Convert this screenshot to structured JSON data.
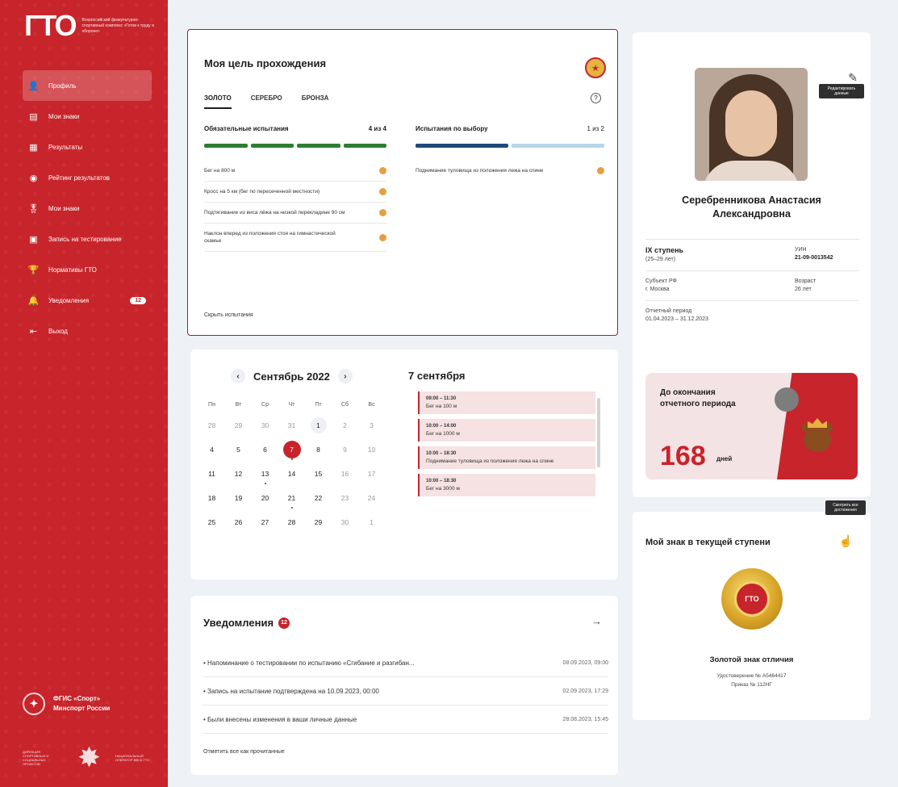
{
  "sidebar": {
    "logo": "ГТО",
    "logo_caption": "Всероссийский физкультурно-спортивный комплекс «Готов к труду и обороне»",
    "items": [
      {
        "label": "Профиль",
        "icon": "user-icon",
        "active": true
      },
      {
        "label": "Мои знаки",
        "icon": "document-icon",
        "active": false
      },
      {
        "label": "Результаты",
        "icon": "calendar-grid-icon",
        "active": false
      },
      {
        "label": "Рейтинг результатов",
        "icon": "target-icon",
        "active": false
      },
      {
        "label": "Мои знаки",
        "icon": "medal-icon",
        "active": false
      },
      {
        "label": "Запись на тестирование",
        "icon": "calendar-icon",
        "active": false
      },
      {
        "label": "Нормативы ГТО",
        "icon": "trophy-icon",
        "active": false
      },
      {
        "label": "Уведомления",
        "icon": "bell-icon",
        "active": false,
        "badge": "12"
      },
      {
        "label": "Выход",
        "icon": "logout-icon",
        "active": false
      }
    ],
    "footer_org": "ФГИС «Спорт»",
    "footer_ministry": "Минспорт России",
    "footer_left": "ДИРЕКЦИЯ СПОРТИВНЫХ И СОЦИАЛЬНЫХ ПРОЕКТОВ",
    "footer_right": "НАЦИОНАЛЬНЫЙ ОПЕРАТОР ВФСК ГТО"
  },
  "goal": {
    "title": "Моя цель прохождения",
    "tabs": [
      "ЗОЛОТО",
      "СЕРЕБРО",
      "БРОНЗА"
    ],
    "mandatory": {
      "title": "Обязательные испытания",
      "count": "4 из 4",
      "items": [
        "Бег на 800 м",
        "Кросс на 5 км (бег по пересеченной местности)",
        "Подтягивание из виса лёжа на низкой перекладине 90 см",
        "Наклон вперед из положения стоя на гимнастической скамье"
      ]
    },
    "optional": {
      "title": "Испытания по выбору",
      "count": "1 из 2",
      "items": [
        "Поднимание туловища из положения лежа на спине"
      ]
    },
    "hide_link": "Скрыть испытания",
    "colors": {
      "done": "#2e7d32",
      "blue": "#1f4a7a",
      "light": "#b7d6e6"
    }
  },
  "calendar": {
    "month": "Сентябрь 2022",
    "weekdays": [
      "Пн",
      "Вт",
      "Ср",
      "Чт",
      "Пт",
      "Сб",
      "Вс"
    ],
    "days": [
      {
        "d": "28",
        "m": true
      },
      {
        "d": "29",
        "m": true
      },
      {
        "d": "30",
        "m": true
      },
      {
        "d": "31",
        "m": true
      },
      {
        "d": "1",
        "o": true
      },
      {
        "d": "2",
        "m": true
      },
      {
        "d": "3",
        "m": true
      },
      {
        "d": "4"
      },
      {
        "d": "5"
      },
      {
        "d": "6"
      },
      {
        "d": "7",
        "t": true
      },
      {
        "d": "8"
      },
      {
        "d": "9",
        "m": true
      },
      {
        "d": "10",
        "m": true
      },
      {
        "d": "11"
      },
      {
        "d": "12"
      },
      {
        "d": "13",
        "e": true
      },
      {
        "d": "14"
      },
      {
        "d": "15"
      },
      {
        "d": "16",
        "m": true
      },
      {
        "d": "17",
        "m": true
      },
      {
        "d": "18"
      },
      {
        "d": "19"
      },
      {
        "d": "20"
      },
      {
        "d": "21",
        "e": true
      },
      {
        "d": "22"
      },
      {
        "d": "23",
        "m": true
      },
      {
        "d": "24",
        "m": true
      },
      {
        "d": "25"
      },
      {
        "d": "26"
      },
      {
        "d": "27"
      },
      {
        "d": "28"
      },
      {
        "d": "29"
      },
      {
        "d": "30",
        "m": true
      },
      {
        "d": "1",
        "m": true
      }
    ],
    "day_title": "7 сентября",
    "events": [
      {
        "time": "09:00 – 11:30",
        "text": "Бег на 100 м"
      },
      {
        "time": "10:00 – 14:00",
        "text": "Бег на 1000 м"
      },
      {
        "time": "10:00 – 18:30",
        "text": "Поднимание туловища из положения лежа на спине"
      },
      {
        "time": "10:00 – 18:30",
        "text": "Бег на 3000 м"
      }
    ]
  },
  "notifications": {
    "title": "Уведомления",
    "badge": "12",
    "rows": [
      {
        "text": "Напоминание о тестировании по испытанию «Сгибание и разгибан...",
        "date": "08.09.2023, 09:00"
      },
      {
        "text": "Запись на испытание подтверждена на 10.09.2023, 00:00",
        "date": "02.09.2023, 17:29"
      },
      {
        "text": "Были внесены изменения в ваши личные данные",
        "date": "28.08.2023, 15:45"
      }
    ],
    "mark_all": "Отметить все как прочитанные"
  },
  "profile": {
    "name_line1": "Серебренникова Анастасия",
    "name_line2": "Александровна",
    "edit_tooltip": "Редактировать данные",
    "stage": "IX ступень",
    "stage_age": "(25–29 лет)",
    "uin_label": "УИН",
    "uin": "21-09-0013542",
    "region_label": "Субъект РФ",
    "region": "г. Москва",
    "age_label": "Возраст",
    "age": "26 лет",
    "period_label": "Отчетный период",
    "period": "01.04.2023 – 31.12.2023",
    "countdown_text": "До окончания отчетного периода",
    "countdown_days": "168",
    "countdown_unit": "дней"
  },
  "badge": {
    "title": "Мой знак в текущей ступени",
    "share_tooltip": "Смотреть все достижения",
    "medal_text": "ГТО",
    "name": "Золотой знак отличия",
    "cert": "Удостоверение № А5464417",
    "order": "Приказ № 112НГ"
  }
}
